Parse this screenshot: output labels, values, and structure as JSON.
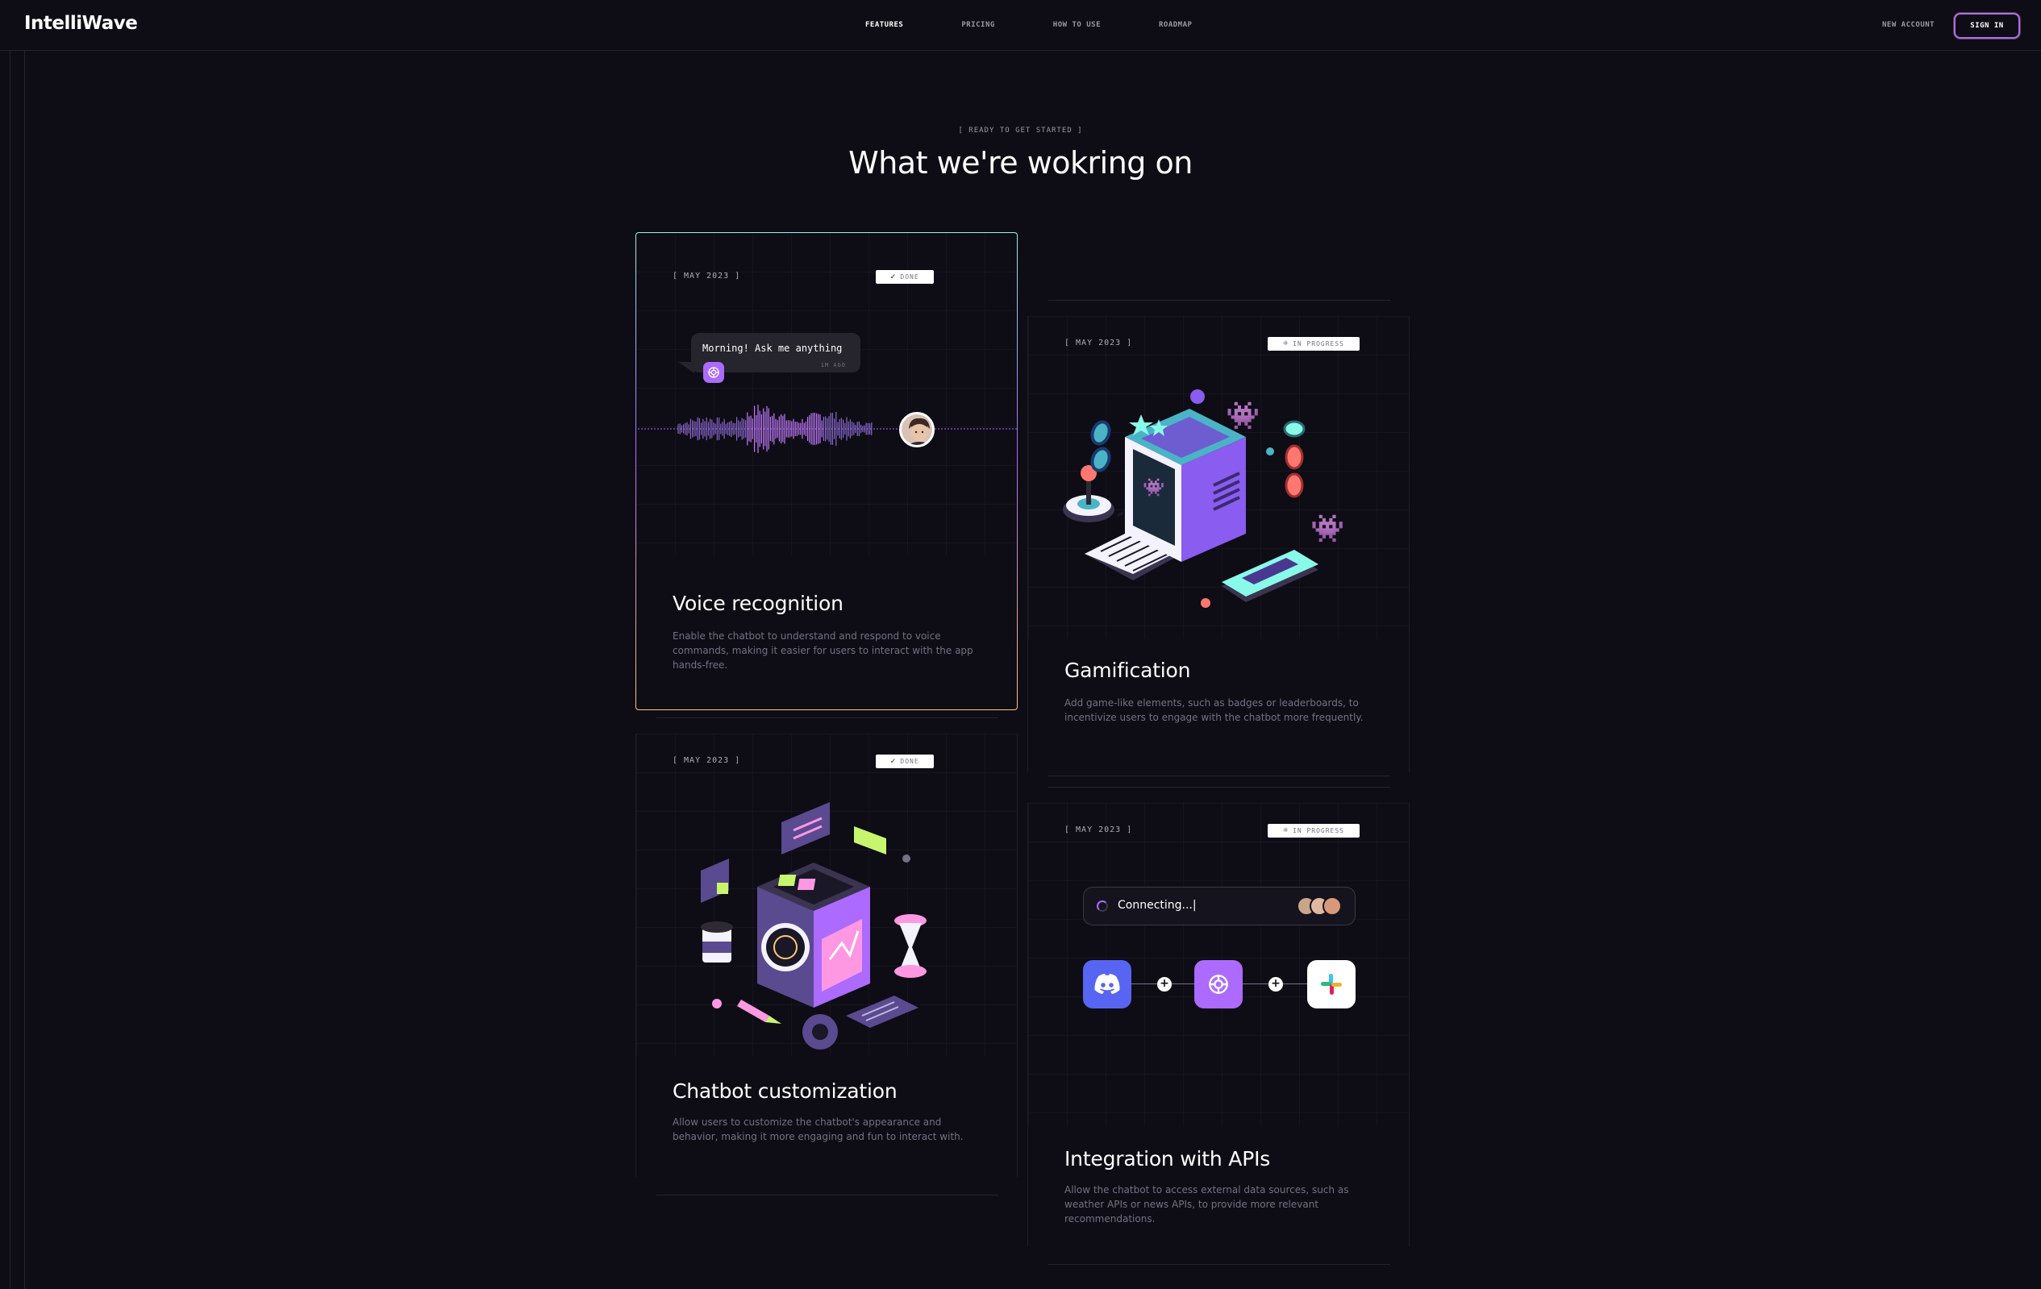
{
  "brand": {
    "name": "IntelliWave"
  },
  "nav": {
    "items": [
      {
        "label": "FEATURES",
        "active": true
      },
      {
        "label": "PRICING",
        "active": false
      },
      {
        "label": "HOW TO USE",
        "active": false
      },
      {
        "label": "ROADMAP",
        "active": false
      }
    ],
    "new_account": "NEW ACCOUNT",
    "sign_in": "SIGN IN"
  },
  "section": {
    "eyebrow": "[  READY TO GET STARTED  ]",
    "title": "What we're wokring on"
  },
  "cards": [
    {
      "date": "[  MAY 2023  ]",
      "status": "DONE",
      "status_icon": "check-icon",
      "title": "Voice recognition",
      "description": "Enable the chatbot to understand and respond to voice commands, making it easier for users to interact with the app hands-free.",
      "chat_bubble": {
        "text": "Morning! Ask me anything",
        "time": "1M AGO"
      }
    },
    {
      "date": "[  MAY 2023  ]",
      "status": "IN PROGRESS",
      "status_icon": "loading-icon",
      "title": "Gamification",
      "description": "Add game-like elements, such as badges or leaderboards, to incentivize users to engage with the chatbot more frequently."
    },
    {
      "date": "[  MAY 2023  ]",
      "status": "DONE",
      "status_icon": "check-icon",
      "title": "Chatbot customization",
      "description": "Allow users to customize the chatbot's appearance and behavior, making it more engaging and fun to interact with."
    },
    {
      "date": "[  MAY 2023  ]",
      "status": "IN PROGRESS",
      "status_icon": "loading-icon",
      "title": "Integration with APIs",
      "description": "Allow the chatbot to access external data sources, such as weather APIs or news APIs, to provide more relevant recommendations.",
      "connect_text": "Connecting...|"
    }
  ],
  "colors": {
    "background": "#0e0c15",
    "accent_purple": "#ac6aff",
    "accent_teal": "#89f9e8",
    "accent_orange": "#ff776f",
    "accent_yellow": "#ffc876",
    "muted_text": "#757185",
    "discord": "#5865f2"
  }
}
